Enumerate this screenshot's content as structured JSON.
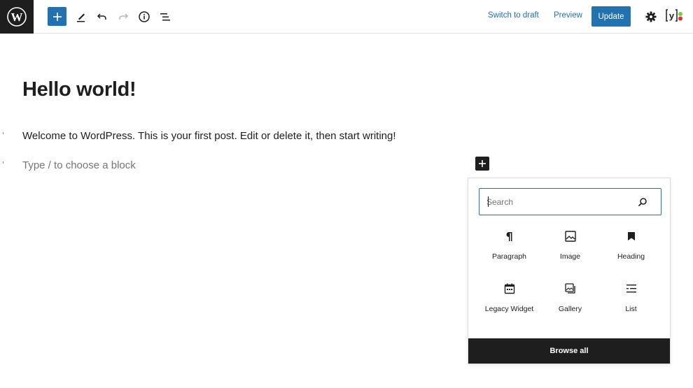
{
  "toolbar": {
    "logo_icon": "wordpress-logo-icon",
    "add_block_icon": "plus-icon",
    "tools_icon": "pencil-icon",
    "undo_icon": "undo-icon",
    "redo_icon": "redo-icon",
    "details_icon": "info-icon",
    "outline_icon": "list-view-icon",
    "switch_to_draft": "Switch to draft",
    "preview": "Preview",
    "update": "Update",
    "settings_icon": "gear-icon",
    "yoast_icon": "yoast-seo-icon",
    "accent_color": "#2271b1"
  },
  "editor": {
    "title": "Hello world!",
    "paragraph": "Welcome to WordPress. This is your first post. Edit or delete it, then start writing!",
    "placeholder": "Type / to choose a block",
    "inline_add_icon": "plus-icon"
  },
  "inserter": {
    "search_placeholder": "Search",
    "search_value": "",
    "blocks": [
      {
        "label": "Paragraph",
        "icon": "paragraph-icon"
      },
      {
        "label": "Image",
        "icon": "image-icon"
      },
      {
        "label": "Heading",
        "icon": "bookmark-icon"
      },
      {
        "label": "Legacy Widget",
        "icon": "calendar-icon"
      },
      {
        "label": "Gallery",
        "icon": "gallery-icon"
      },
      {
        "label": "List",
        "icon": "list-icon"
      }
    ],
    "browse_all": "Browse all"
  }
}
